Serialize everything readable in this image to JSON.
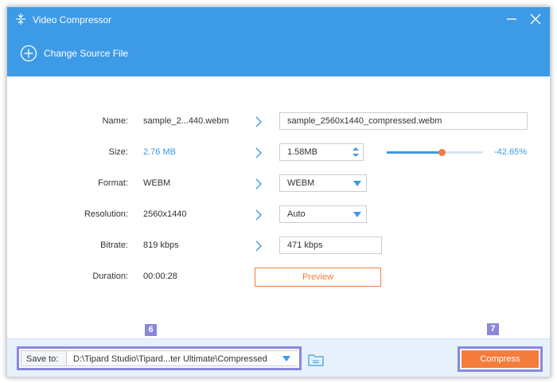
{
  "window": {
    "title": "Video Compressor",
    "accent_color": "#3d9ae6",
    "action_color": "#f47c3c",
    "annotation_color": "#8a87dc"
  },
  "header": {
    "change_source_label": "Change Source File",
    "icon": "plus-circle-icon"
  },
  "fields": {
    "name": {
      "label": "Name:",
      "source": "sample_2...440.webm",
      "output": "sample_2560x1440_compressed.webm"
    },
    "size": {
      "label": "Size:",
      "source": "2.76 MB",
      "output": "1.58MB",
      "slider_fraction": 0.4265,
      "percent": "-42.65%"
    },
    "format": {
      "label": "Format:",
      "source": "WEBM",
      "output": "WEBM"
    },
    "resolution": {
      "label": "Resolution:",
      "source": "2560x1440",
      "output": "Auto"
    },
    "bitrate": {
      "label": "Bitrate:",
      "source": "819 kbps",
      "output": "471 kbps"
    },
    "duration": {
      "label": "Duration:",
      "source": "00:00:28"
    }
  },
  "preview_label": "Preview",
  "footer": {
    "save_to_label": "Save to:",
    "save_path": "D:\\Tipard Studio\\Tipard...ter Ultimate\\Compressed",
    "compress_label": "Compress"
  },
  "annotations": {
    "badge_6": "6",
    "badge_7": "7"
  }
}
